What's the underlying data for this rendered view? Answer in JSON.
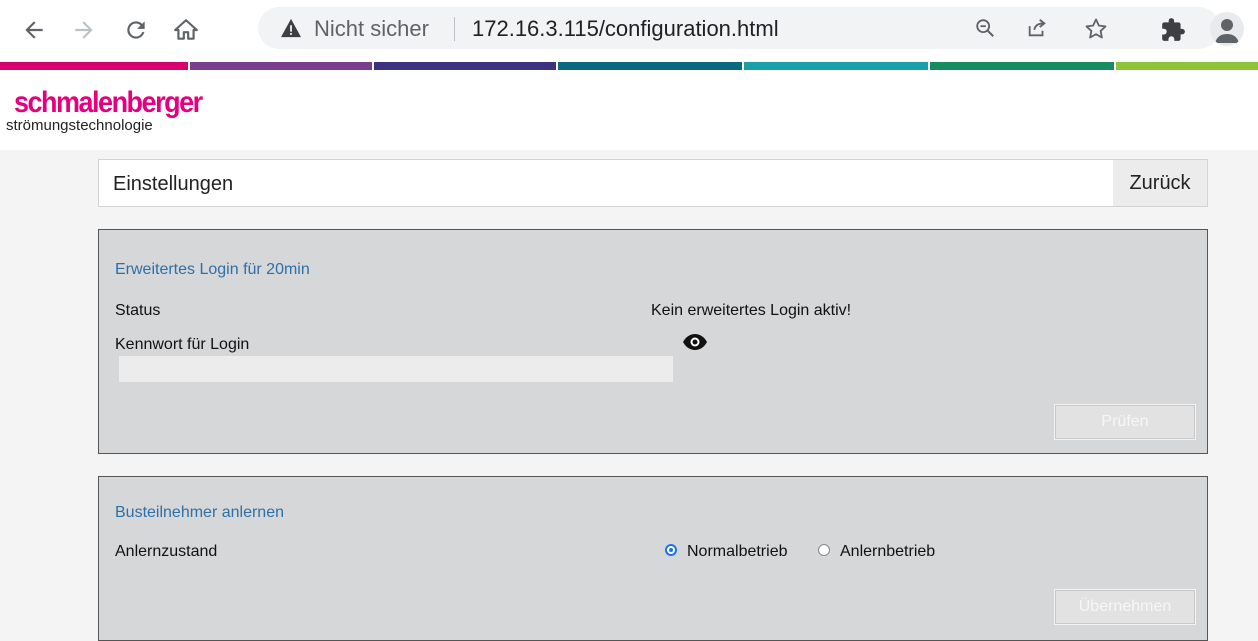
{
  "browser": {
    "security_label": "Nicht sicher",
    "url": "172.16.3.115/configuration.html"
  },
  "logo": {
    "brand": "schmalenberger",
    "tagline": "strömungstechnologie"
  },
  "colors": {
    "brand": "#e5007e",
    "section_title": "#2f6fa7",
    "stripe": [
      "#d6006f",
      "#7b3e8f",
      "#3d3182",
      "#0b6a80",
      "#19a0a8",
      "#168c61",
      "#8fc33a"
    ]
  },
  "header": {
    "title": "Einstellungen",
    "back_label": "Zurück"
  },
  "login_panel": {
    "title": "Erweitertes Login für 20min",
    "status_label": "Status",
    "status_value": "Kein erweitertes Login aktiv!",
    "password_label": "Kennwort für Login",
    "password_value": "",
    "toggle_icon": "eye-icon",
    "check_button": "Prüfen"
  },
  "bus_panel": {
    "title": "Busteilnehmer anlernen",
    "mode_label": "Anlernzustand",
    "options": [
      {
        "label": "Normalbetrieb",
        "selected": true
      },
      {
        "label": "Anlernbetrieb",
        "selected": false
      }
    ],
    "apply_button": "Übernehmen"
  }
}
